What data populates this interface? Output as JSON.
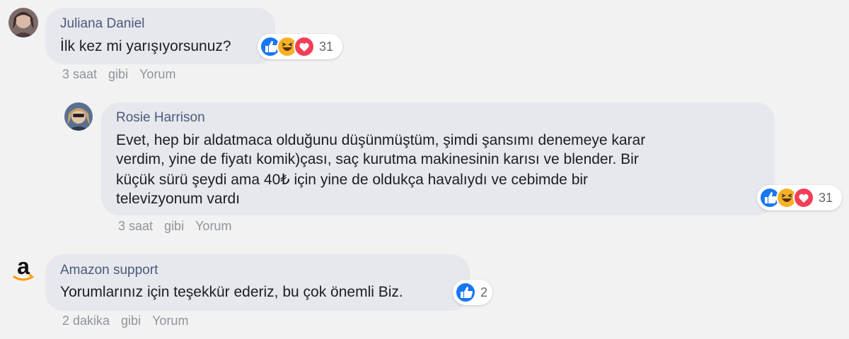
{
  "comments": [
    {
      "author": "Juliana Daniel",
      "lines": [
        "İlk kez mi yarışıyorsunuz?"
      ],
      "reactions": {
        "icons": [
          "like-icon",
          "haha-icon",
          "love-icon"
        ],
        "count": "31"
      },
      "meta": {
        "time": "3 saat",
        "like": "gibi",
        "reply": "Yorum"
      }
    },
    {
      "author": "Rosie Harrison",
      "lines": [
        "Evet, hep bir aldatmaca olduğunu düşünmüştüm, şimdi şansımı denemeye karar",
        "verdim, yine de fiyatı komik)çası, saç kurutma makinesinin karısı ve blender. Bir",
        "küçük sürü şeydi ama 40₺ için yine de oldukça havalıydı ve cebimde bir",
        "televizyonum vardı"
      ],
      "reactions": {
        "icons": [
          "like-icon",
          "haha-icon",
          "love-icon"
        ],
        "count": "31"
      },
      "meta": {
        "time": "3 saat",
        "like": "gibi",
        "reply": "Yorum"
      }
    },
    {
      "author": "Amazon support",
      "lines": [
        "Yorumlarınız için teşekkür ederiz, bu çok önemli Biz."
      ],
      "reactions": {
        "icons": [
          "like-icon"
        ],
        "count": "2"
      },
      "meta": {
        "time": "2 dakika",
        "like": "gibi",
        "reply": "Yorum"
      }
    }
  ],
  "colors": {
    "background": "#f2f2f3",
    "bubble": "#e6e8ed",
    "author": "#4a5a7a",
    "meta": "#8f949c",
    "like": "#1877f2",
    "love": "#f33e58",
    "haha": "#f7b125"
  }
}
